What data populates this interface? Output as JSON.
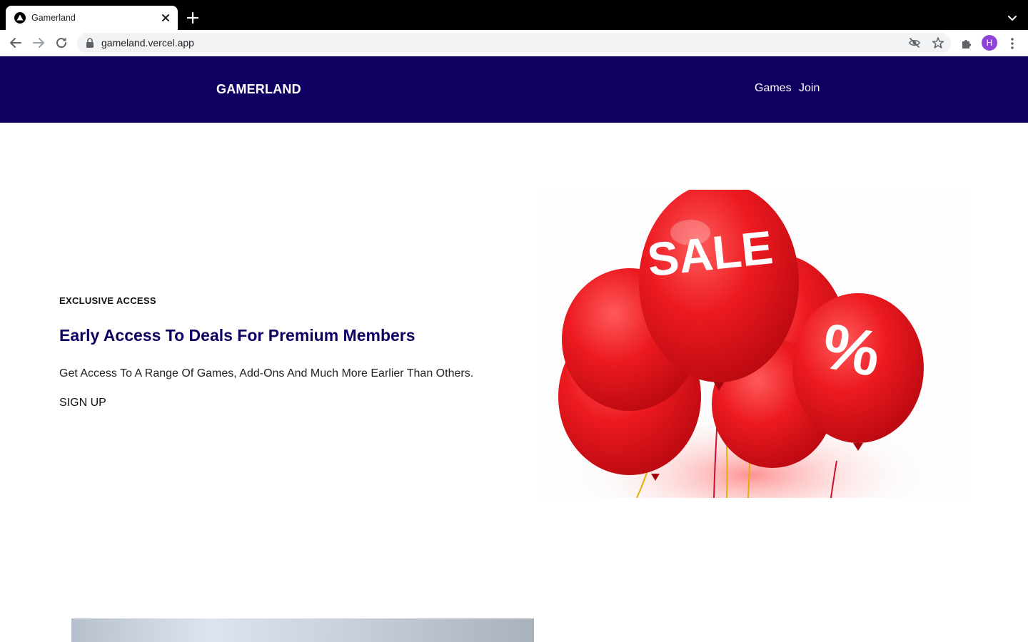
{
  "browser": {
    "tab_title": "Gamerland",
    "url": "gameland.vercel.app",
    "avatar_initial": "H"
  },
  "site": {
    "brand": "GAMERLAND",
    "nav": [
      {
        "label": "Games"
      },
      {
        "label": "Join"
      }
    ]
  },
  "hero": {
    "eyebrow": "EXCLUSIVE ACCESS",
    "headline": "Early Access To Deals For Premium Members",
    "subtext": "Get Access To A Range Of Games, Add-Ons And Much More Earlier Than Others.",
    "cta": "SIGN UP",
    "image": {
      "balloon_text_1": "SALE",
      "balloon_text_2": "%",
      "balloon_color": "#e4141b"
    }
  },
  "colors": {
    "header_bg": "#0e0060",
    "headline": "#0e0060",
    "tabbar_bg": "#000000"
  }
}
